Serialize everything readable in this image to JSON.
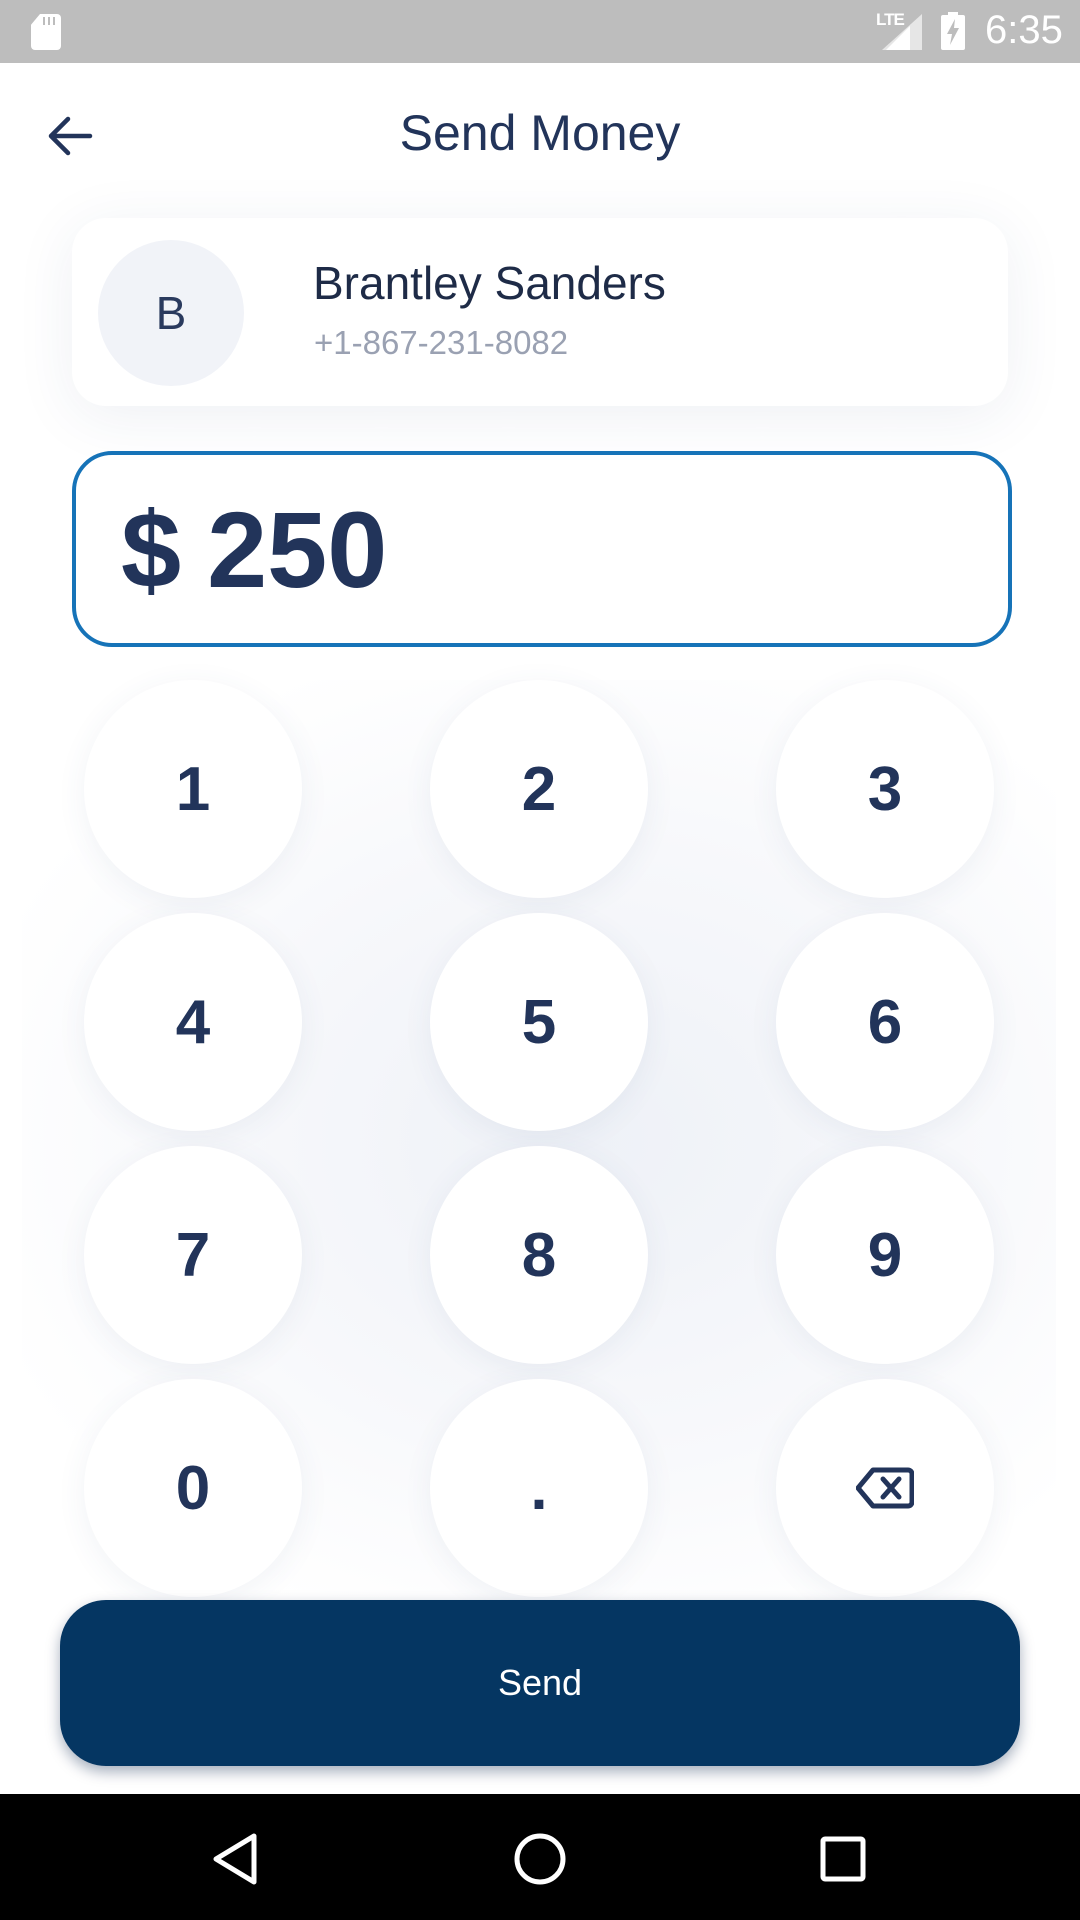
{
  "status_bar": {
    "network": "LTE",
    "time": "6:35",
    "icons": [
      "sd-card-icon",
      "signal-icon",
      "battery-charging-icon"
    ]
  },
  "header": {
    "back_icon": "arrow-left-icon",
    "title": "Send Money"
  },
  "recipient": {
    "initial": "B",
    "name": "Brantley Sanders",
    "phone": "+1-867-231-8082"
  },
  "amount": {
    "currency": "$",
    "value": "250"
  },
  "keypad": {
    "keys": [
      "1",
      "2",
      "3",
      "4",
      "5",
      "6",
      "7",
      "8",
      "9",
      "0",
      "."
    ],
    "backspace_icon": "backspace-icon"
  },
  "send_button": {
    "label": "Send"
  },
  "nav_bar": {
    "icons": [
      "back-triangle-icon",
      "home-circle-icon",
      "recents-square-icon"
    ]
  },
  "colors": {
    "accent_border": "#1673b8",
    "primary_button": "#053662",
    "text_dark": "#22345a",
    "text_muted": "#9aa1b2"
  }
}
